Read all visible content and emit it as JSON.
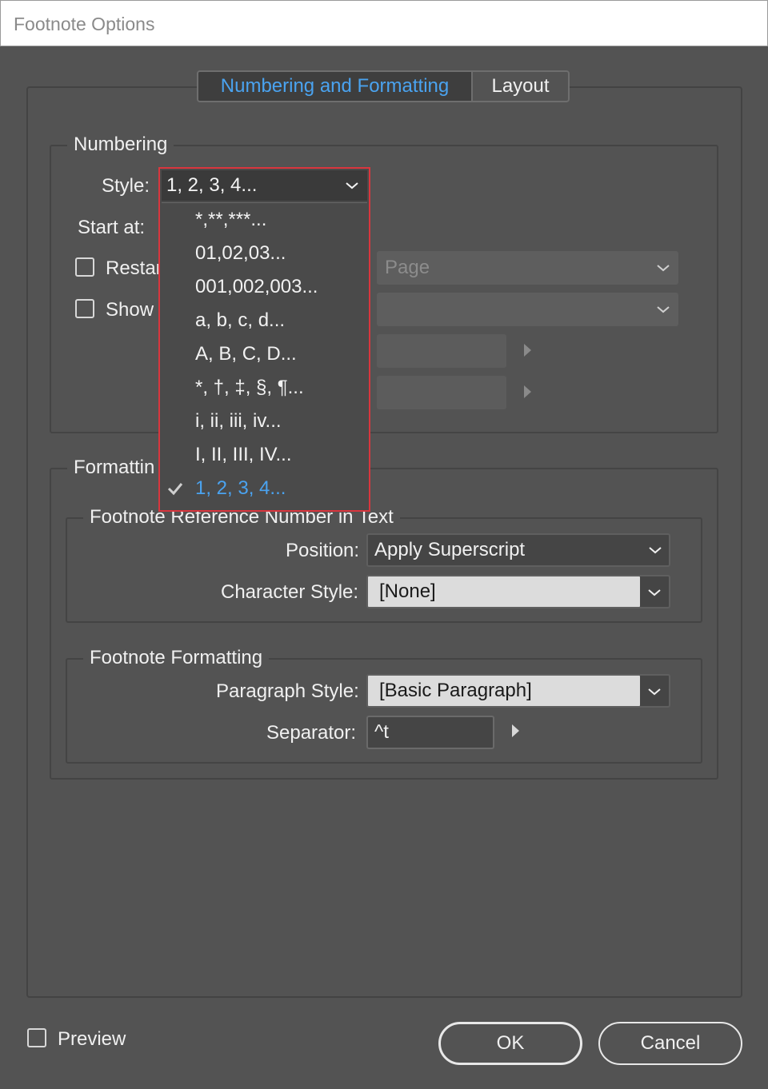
{
  "window": {
    "title": "Footnote Options"
  },
  "tabs": [
    {
      "label": "Numbering and Formatting",
      "active": true
    },
    {
      "label": "Layout",
      "active": false
    }
  ],
  "numbering": {
    "group_title": "Numbering",
    "style_label": "Style:",
    "style_value": "1, 2, 3, 4...",
    "start_at_label": "Start at:",
    "restart_label": "Restar",
    "restart_checked": false,
    "restart_every_value": "Page",
    "show_label": "Show",
    "show_checked": false,
    "style_options": [
      {
        "label": "*,**,***...",
        "selected": false
      },
      {
        "label": "01,02,03...",
        "selected": false
      },
      {
        "label": "001,002,003...",
        "selected": false
      },
      {
        "label": "a, b, c, d...",
        "selected": false
      },
      {
        "label": "A, B, C, D...",
        "selected": false
      },
      {
        "label": "*, †, ‡, §, ¶...",
        "selected": false
      },
      {
        "label": "i, ii, iii, iv...",
        "selected": false
      },
      {
        "label": "I, II, III, IV...",
        "selected": false
      },
      {
        "label": "1, 2, 3, 4...",
        "selected": true
      }
    ]
  },
  "formatting": {
    "group_title": "Formattin",
    "reference": {
      "group_title": "Footnote Reference Number in Text",
      "position_label": "Position:",
      "position_value": "Apply Superscript",
      "char_style_label": "Character Style:",
      "char_style_value": "[None]"
    },
    "footnote": {
      "group_title": "Footnote Formatting",
      "para_style_label": "Paragraph Style:",
      "para_style_value": "[Basic Paragraph]",
      "separator_label": "Separator:",
      "separator_value": "^t"
    }
  },
  "footer": {
    "preview_label": "Preview",
    "preview_checked": false,
    "ok_label": "OK",
    "cancel_label": "Cancel"
  },
  "colors": {
    "background": "#535353",
    "accent": "#4aa3f0",
    "popup_border": "#d9363e"
  },
  "icons": {
    "chevron": "chevron-down-icon",
    "arrow": "triangle-right-icon",
    "check": "checkmark-icon"
  }
}
